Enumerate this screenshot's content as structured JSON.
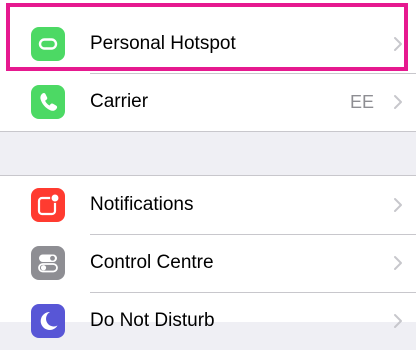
{
  "rows_group1": [
    {
      "label": "Personal Hotspot",
      "value": "",
      "icon": "link-icon",
      "color": "#4cd964"
    },
    {
      "label": "Carrier",
      "value": "EE",
      "icon": "phone-icon",
      "color": "#4cd964"
    }
  ],
  "rows_group2": [
    {
      "label": "Notifications",
      "value": "",
      "icon": "notifications-icon",
      "color": "#ff3b30"
    },
    {
      "label": "Control Centre",
      "value": "",
      "icon": "toggles-icon",
      "color": "#8e8e93"
    },
    {
      "label": "Do Not Disturb",
      "value": "",
      "icon": "moon-icon",
      "color": "#5856d6"
    }
  ],
  "highlight_color": "#e6198f"
}
